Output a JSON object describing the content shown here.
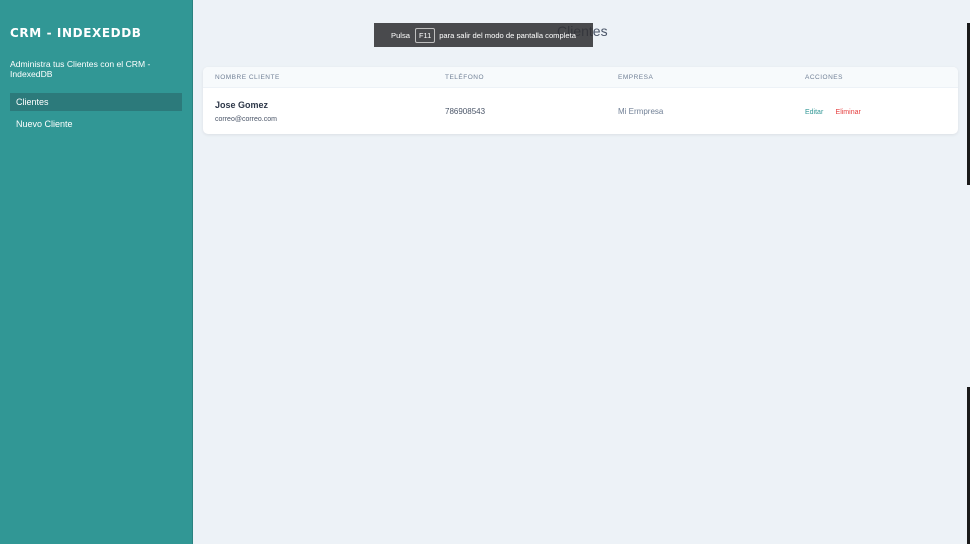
{
  "sidebar": {
    "brand": "CRM - INDEXEDDB",
    "tagline": "Administra tus Clientes con el CRM - IndexedDB",
    "nav": [
      {
        "label": "Clientes",
        "active": true
      },
      {
        "label": "Nuevo Cliente",
        "active": false
      }
    ]
  },
  "main": {
    "title": "Clientes",
    "table": {
      "headers": [
        "NOMBRE CLIENTE",
        "TELÉFONO",
        "EMPRESA",
        "ACCIONES"
      ],
      "rows": [
        {
          "name": "Jose Gomez",
          "email": "correo@correo.com",
          "phone": "786908543",
          "company": "Mi Ermpresa",
          "edit_label": "Editar",
          "delete_label": "Eliminar"
        }
      ]
    }
  },
  "fullscreen_toast": {
    "prefix": "Pulsa",
    "key": "F11",
    "suffix": "para salir del modo de pantalla completa"
  },
  "colors": {
    "sidebar_bg": "#319795",
    "active_nav_bg": "#2c7a7b",
    "page_bg": "#edf2f7",
    "edit_color": "#319795",
    "delete_color": "#e53e3e"
  }
}
